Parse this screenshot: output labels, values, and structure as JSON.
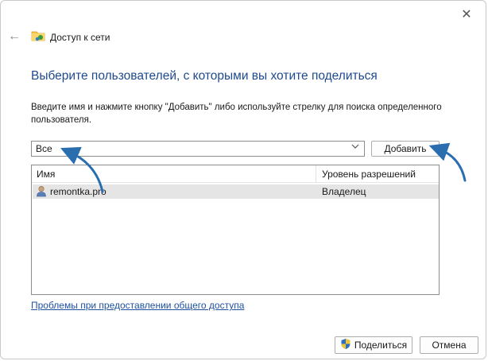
{
  "window": {
    "title": "Доступ к сети",
    "close_glyph": "✕",
    "back_glyph": "←"
  },
  "main": {
    "heading": "Выберите пользователей, с которыми вы хотите поделиться",
    "description": "Введите имя и нажмите кнопку \"Добавить\" либо используйте стрелку для поиска определенного пользователя.",
    "combo_value": "Все",
    "add_label": "Добавить",
    "columns": {
      "name": "Имя",
      "permission": "Уровень разрешений"
    },
    "rows": [
      {
        "name": "remontka.pro",
        "permission": "Владелец"
      }
    ],
    "help_link": "Проблемы при предоставлении общего доступа"
  },
  "footer": {
    "share_label": "Поделиться",
    "cancel_label": "Отмена"
  },
  "colors": {
    "heading": "#1e4a8c",
    "link": "#1e50a2",
    "annotation_arrow": "#2a6eb0",
    "selected_row": "#e5e5e5"
  },
  "icons": [
    "close-icon",
    "back-arrow-icon",
    "network-folder-icon",
    "user-icon",
    "shield-icon",
    "chevron-down-icon"
  ]
}
